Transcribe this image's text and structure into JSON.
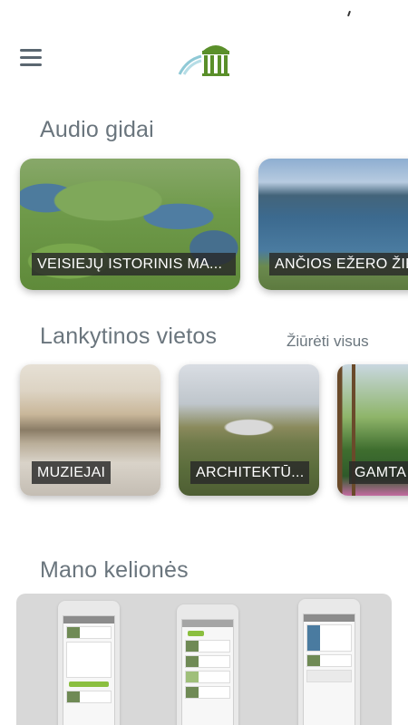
{
  "header": {
    "menu_icon": "hamburger-menu-icon",
    "logo_icon": "rotunda-logo-icon",
    "logo_colors": {
      "green": "#5a8f2a",
      "arc": "#8fc9d6"
    }
  },
  "audio_guides": {
    "title": "Audio gidai",
    "items": [
      {
        "label": "VEISIEJŲ ISTORINIS MA..."
      },
      {
        "label": "ANČIOS EŽERO ŽIE"
      }
    ]
  },
  "places": {
    "title": "Lankytinos vietos",
    "see_all_label": "Žiūrėti visus",
    "items": [
      {
        "label": "MUZIEJAI"
      },
      {
        "label": "ARCHITEKTŪ..."
      },
      {
        "label": "GAMTA"
      }
    ]
  },
  "trips": {
    "title": "Mano kelionės"
  },
  "colors": {
    "text": "#6a757d",
    "label_bg": "#282828",
    "label_text": "#ffffff"
  }
}
